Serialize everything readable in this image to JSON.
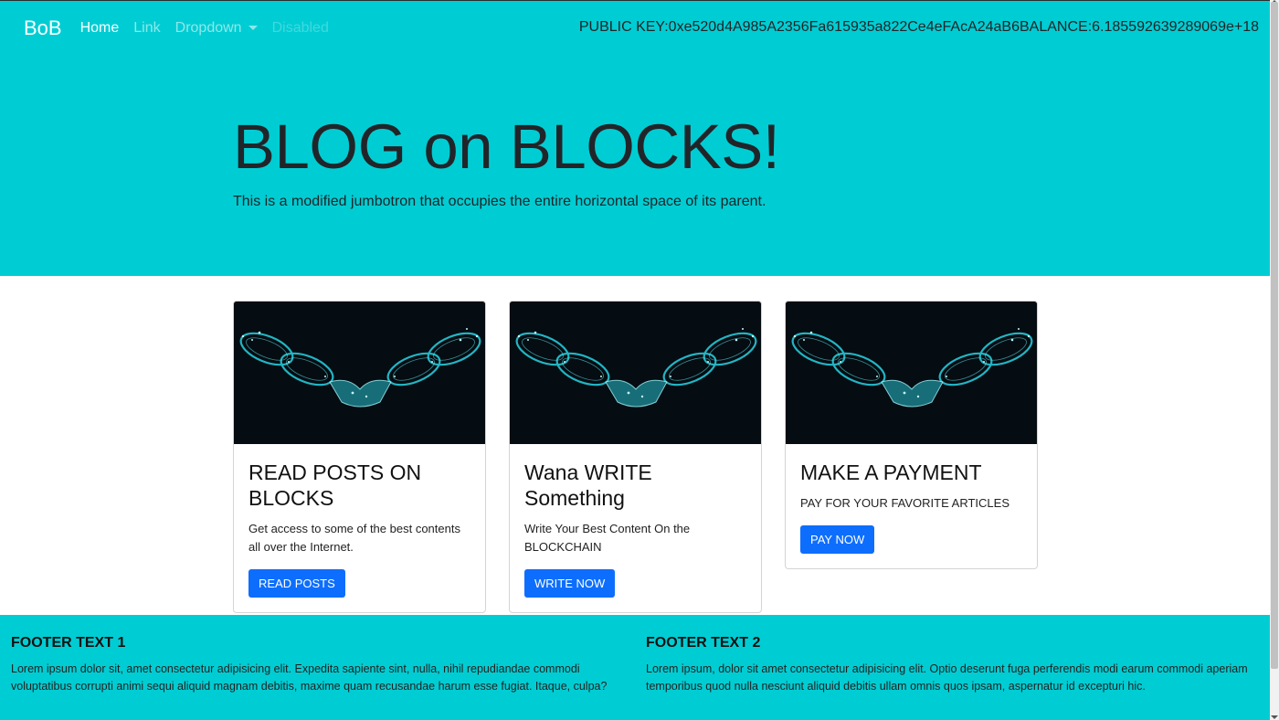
{
  "navbar": {
    "brand": "BoB",
    "links": [
      {
        "label": "Home"
      },
      {
        "label": "Link"
      },
      {
        "label": "Dropdown"
      },
      {
        "label": "Disabled"
      }
    ],
    "public_key_label": "PUBLIC KEY:",
    "public_key": "0xe520d4A985A2356Fa615935a822Ce4eFAcA24aB6",
    "balance_label": "BALANCE:",
    "balance": "6.185592639289069e+18"
  },
  "jumbotron": {
    "title": "BLOG on BLOCKS!",
    "lead": "This is a modified jumbotron that occupies the entire horizontal space of its parent."
  },
  "cards": [
    {
      "title": "READ POSTS ON BLOCKS",
      "text": "Get access to some of the best contents all over the Internet.",
      "button": "READ POSTS"
    },
    {
      "title": "Wana WRITE Something",
      "text": "Write Your Best Content On the BLOCKCHAIN",
      "button": "WRITE NOW"
    },
    {
      "title": "MAKE A PAYMENT",
      "text": "PAY FOR YOUR FAVORITE ARTICLES",
      "button": "PAY NOW"
    }
  ],
  "footer": {
    "col1": {
      "title": "FOOTER TEXT 1",
      "text": "Lorem ipsum dolor sit, amet consectetur adipisicing elit. Expedita sapiente sint, nulla, nihil repudiandae commodi voluptatibus corrupti animi sequi aliquid magnam debitis, maxime quam recusandae harum esse fugiat. Itaque, culpa?"
    },
    "col2": {
      "title": "FOOTER TEXT 2",
      "text": "Lorem ipsum, dolor sit amet consectetur adipisicing elit. Optio deserunt fuga perferendis modi earum commodi aperiam temporibus quod nulla nesciunt aliquid debitis ullam omnis quos ipsam, aspernatur id excepturi hic."
    }
  },
  "colors": {
    "accent": "#00cdd3",
    "button": "#0d6efd",
    "card_image_bg": "#050d12",
    "chain_glow": "#27c8d8"
  },
  "icons": {
    "card_image": "blockchain-handshake-image",
    "dropdown_caret": "chevron-down-icon"
  }
}
